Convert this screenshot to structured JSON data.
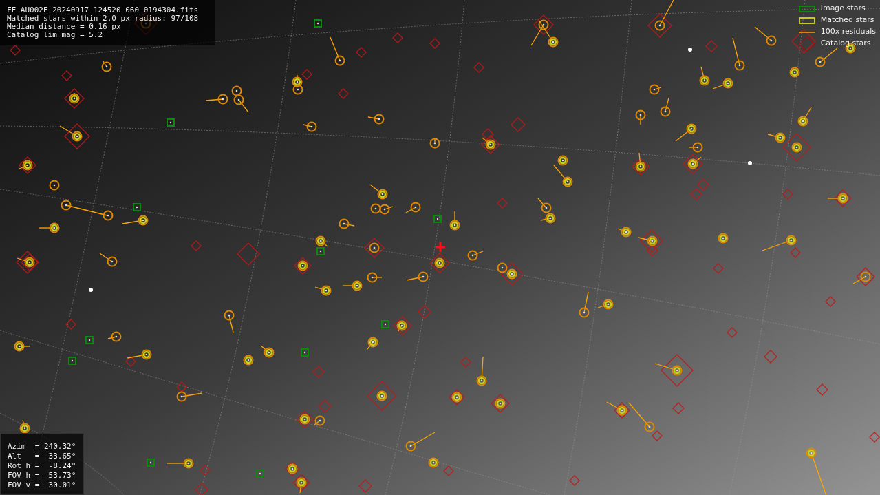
{
  "info_panel": {
    "lines": [
      "FF_AU002E_20240917_124520_060_0194304.fits",
      "Matched stars within 2.0 px radius: 97/108",
      "Median distance = 0.16 px",
      "Catalog lim mag = 5.2"
    ]
  },
  "legend": {
    "items": [
      {
        "kind": "image",
        "label": "Image stars"
      },
      {
        "kind": "matched",
        "label": "Matched stars"
      },
      {
        "kind": "residual",
        "label": "100x residuals"
      },
      {
        "kind": "catalog",
        "label": "Catalog stars"
      }
    ]
  },
  "pointing_panel": {
    "lines": [
      "Azim  = 240.32°",
      "Alt   =  33.65°",
      "Rot h =  -8.24°",
      "FOV h =  53.73°",
      "FOV v =  30.01°"
    ]
  }
}
